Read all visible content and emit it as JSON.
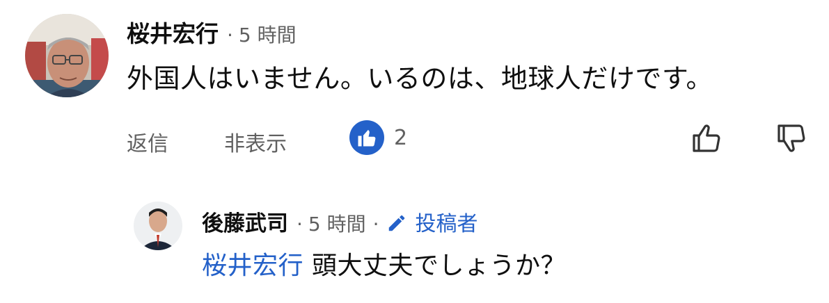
{
  "comment": {
    "author": "桜井宏行",
    "separator": "·",
    "timestamp": "5 時間",
    "text": "外国人はいません。いるのは、地球人だけです。",
    "actions": {
      "reply_label": "返信",
      "hide_label": "非表示",
      "like_count": "2"
    }
  },
  "reply": {
    "author": "後藤武司",
    "separator": "·",
    "timestamp": "5 時間",
    "separator2": "·",
    "creator_label": "投稿者",
    "mention": "桜井宏行",
    "text": " 頭大丈夫でしょうか？"
  },
  "icons": {
    "like_badge": "thumbs-up-icon",
    "thumbs_up": "thumbs-up-outline-icon",
    "thumbs_down": "thumbs-down-outline-icon",
    "creator": "pencil-icon"
  },
  "colors": {
    "accent": "#2461c9",
    "meta": "#606060",
    "text": "#0f0f0f"
  }
}
